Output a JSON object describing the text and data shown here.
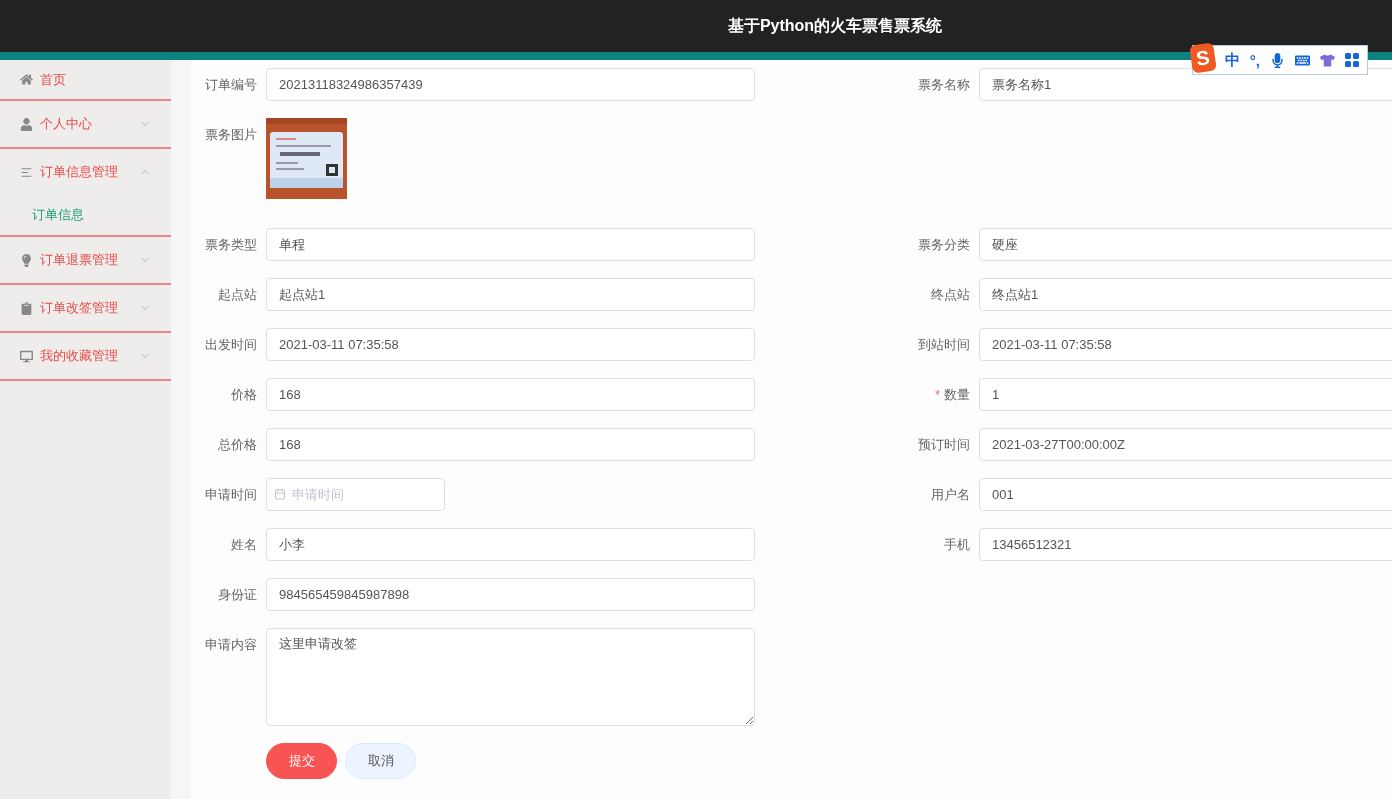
{
  "header": {
    "title": "基于Python的火车票售票系统"
  },
  "ime_toolbar": {
    "logo": "S",
    "mode": "中",
    "punctuation": "°,"
  },
  "sidebar": {
    "items": [
      {
        "label": "首页"
      },
      {
        "label": "个人中心",
        "expanded": false
      },
      {
        "label": "订单信息管理",
        "expanded": true,
        "children": [
          {
            "label": "订单信息",
            "selected": true
          }
        ]
      },
      {
        "label": "订单退票管理",
        "expanded": false
      },
      {
        "label": "订单改签管理",
        "expanded": false
      },
      {
        "label": "我的收藏管理",
        "expanded": false
      }
    ]
  },
  "form": {
    "rows": [
      {
        "fields": [
          {
            "kind": "input",
            "label": "订单编号",
            "value": "20213118324986357439"
          },
          {
            "kind": "input",
            "label": "票务名称",
            "value": "票务名称1"
          }
        ]
      },
      {
        "fields": [
          {
            "label": "票务图片"
          }
        ]
      },
      {
        "fields": [
          {
            "kind": "input",
            "label": "票务类型",
            "value": "单程"
          },
          {
            "kind": "input",
            "label": "票务分类",
            "value": "硬座"
          }
        ]
      },
      {
        "fields": [
          {
            "kind": "input",
            "label": "起点站",
            "value": "起点站1"
          },
          {
            "kind": "input",
            "label": "终点站",
            "value": "终点站1"
          }
        ]
      },
      {
        "fields": [
          {
            "kind": "input",
            "label": "出发时间",
            "value": "2021-03-11 07:35:58"
          },
          {
            "kind": "input",
            "label": "到站时间",
            "value": "2021-03-11 07:35:58"
          }
        ]
      },
      {
        "fields": [
          {
            "kind": "input",
            "label": "价格",
            "value": "168"
          },
          {
            "kind": "input",
            "label": "数量",
            "required_mark": "*",
            "value": "1"
          }
        ]
      },
      {
        "fields": [
          {
            "kind": "input",
            "label": "总价格",
            "value": "168"
          },
          {
            "kind": "input",
            "label": "预订时间",
            "value": "2021-03-27T00:00:00Z"
          }
        ]
      },
      {
        "fields": [
          {
            "kind": "date",
            "label": "申请时间",
            "placeholder": "申请时间"
          },
          {
            "kind": "input",
            "label": "用户名",
            "value": "001"
          }
        ]
      },
      {
        "fields": [
          {
            "kind": "input",
            "label": "姓名",
            "value": "小李"
          },
          {
            "kind": "input",
            "label": "手机",
            "value": "13456512321"
          }
        ]
      },
      {
        "fields": [
          {
            "kind": "input",
            "label": "身份证",
            "value": "984565459845987898"
          }
        ]
      },
      {
        "fields": [
          {
            "kind": "textarea",
            "label": "申请内容",
            "value": "这里申请改签"
          }
        ]
      }
    ],
    "buttons": [
      {
        "label": "提交",
        "kind": "primary"
      },
      {
        "label": "取消",
        "kind": "secondary"
      }
    ]
  }
}
